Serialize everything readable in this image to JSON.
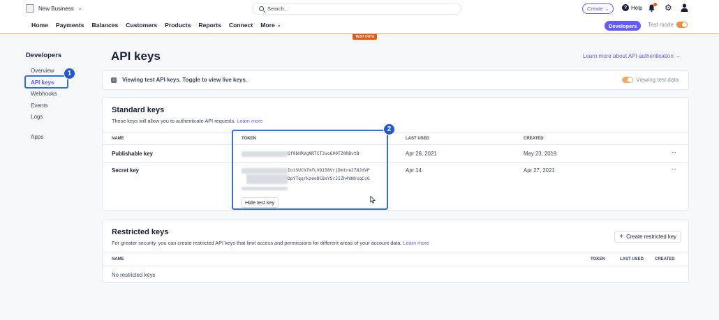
{
  "topbar": {
    "account_name": "New Business",
    "search_placeholder": "Search...",
    "create_label": "Create",
    "help_label": "Help"
  },
  "nav": {
    "items": [
      "Home",
      "Payments",
      "Balances",
      "Customers",
      "Products",
      "Reports",
      "Connect",
      "More"
    ],
    "developers_label": "Developers",
    "test_mode_label": "Test mode",
    "test_data_tag": "TEST DATA"
  },
  "sidebar": {
    "title": "Developers",
    "items": [
      "Overview",
      "API keys",
      "Webhooks",
      "Events",
      "Logs",
      "Apps"
    ]
  },
  "annotations": {
    "badge1": "1",
    "badge2": "2"
  },
  "main": {
    "title": "API keys",
    "learn_more_auth": "Learn more about API authentication →",
    "banner_text": "Viewing test API keys. Toggle to view live keys.",
    "banner_toggle_label": "Viewing test data"
  },
  "standard_keys": {
    "title": "Standard keys",
    "subtitle": "These keys will allow you to authenticate API requests.",
    "learn_more": "Learn more",
    "columns": [
      "NAME",
      "TOKEN",
      "LAST USED",
      "CREATED"
    ],
    "rows": [
      {
        "name": "Publishable key",
        "token_visible": "Gf0bHRVgNRTCT3vo600TZ0RBvtB",
        "last_used": "Apr 28, 2021",
        "created": "May 23, 2019"
      },
      {
        "name": "Secret key",
        "token_line1": "IoiSUCh7mfLVO158VrjDmtre278JdVP",
        "token_line2": "DpYTqqrkzeeDCBsYSrJIZh4VNVsqCcG",
        "last_used": "Apr 14",
        "created": "Apr 27, 2021"
      }
    ],
    "hide_button": "Hide test key"
  },
  "restricted_keys": {
    "title": "Restricted keys",
    "subtitle": "For greater security, you can create restricted API keys that limit access and permissions for different areas of your account data.",
    "learn_more": "Learn more",
    "create_button": "Create restricted key",
    "columns": [
      "NAME",
      "TOKEN",
      "LAST USED",
      "CREATED"
    ],
    "empty_text": "No restricted keys"
  }
}
